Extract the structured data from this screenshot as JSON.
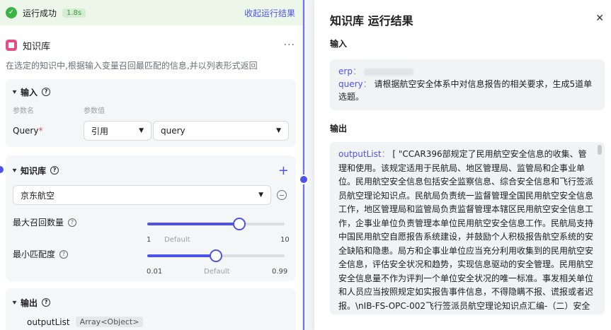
{
  "status": {
    "text": "运行成功",
    "time": "1.8s",
    "collapse_label": "收起运行结果"
  },
  "node": {
    "title": "知识库",
    "more": "···",
    "description": "在选定的知识中,根据输入变量召回最匹配的信息,并以列表形式返回"
  },
  "input_section": {
    "title": "输入",
    "col_param_name": "参数名",
    "col_param_value": "参数值",
    "param": {
      "name": "Query",
      "required_mark": "*",
      "mode": "引用",
      "value": "query"
    }
  },
  "knowledge_section": {
    "title": "知识库",
    "add": "+",
    "selected": "京东航空",
    "max_recall": {
      "label": "最大召回数量",
      "min": "1",
      "default_label": "Default",
      "max": "10",
      "value_fraction": 0.67
    },
    "min_match": {
      "label": "最小匹配度",
      "min": "0.01",
      "default_label": "Default",
      "max": "0.99",
      "value_fraction": 0.5
    }
  },
  "output_section": {
    "title": "输出",
    "item_name": "outputList",
    "item_type": "Array<Object>"
  },
  "result_panel": {
    "title": "知识库 运行结果",
    "close": "✕",
    "input_label": "输入",
    "input_erp_key": "erp",
    "input_sep": "：",
    "input_query_key": "query",
    "input_query_value": "请根据航空安全体系中对信息报告的相关要求，生成5道单选题。",
    "output_label": "输出",
    "output_key": "outputList",
    "output_value": "[ \"CCAR396部规定了民用航空安全信息的收集、管理和使用。该规定适用于民航局、地区管理局、监管局和企事业单位。民用航空安全信息包括安全监察信息、综合安全信息和飞行签派员航空理论知识点。民航局负责统一监督管理全国民用航空安全信息工作，地区管理局和监管局负责监督管理本辖区民用航空安全信息工作，企事业单位负责管理本单位民用航空安全信息工作。民航局支持中国民用航空自愿报告系统建设，并鼓励个人积极报告航空系统的安全缺陷和隐患。局方和企事业单位应当充分利用收集到的民用航空安全信息，评估安全状况和趋势，实现信息驱动的安全管理。民用航空安全信息量不作为评判一个单位安全状况的唯一标准。事发相关单位和人员应当按照规定如实报告事件信息，不得隐瞒不报、谎报或者迟报。\\nIB-FS-OPC-002飞行签派员航空理论知识点汇编-（二）安全监察信"
  },
  "colors": {
    "accent": "#4d53e8",
    "success": "#3bb346",
    "required": "#e5484d",
    "node_icon": "#e24e8a"
  }
}
